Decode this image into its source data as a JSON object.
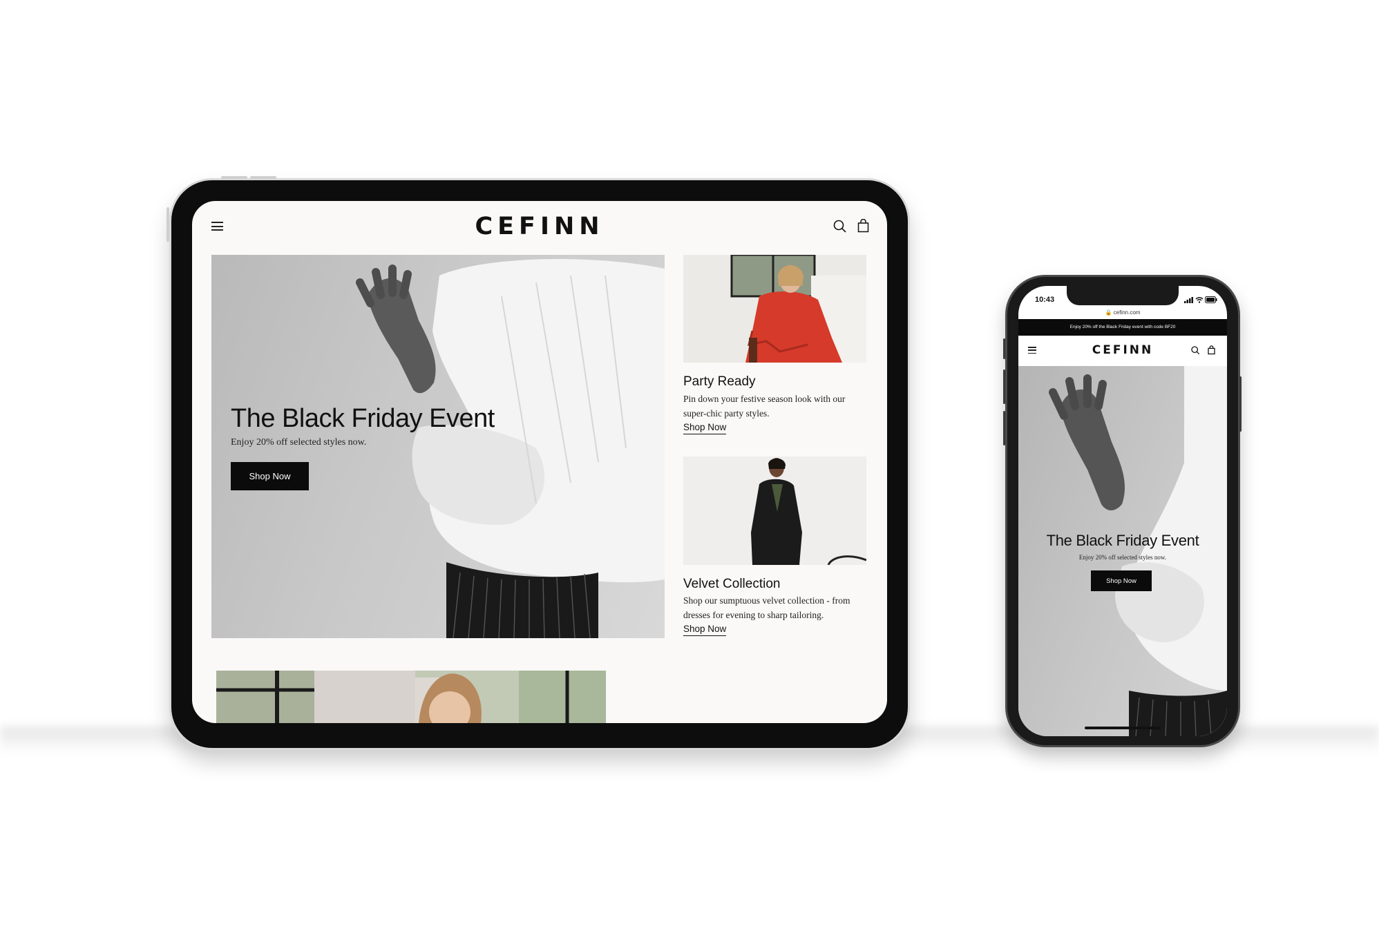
{
  "brand": {
    "logo": "CEFINN"
  },
  "tablet": {
    "hero": {
      "title": "The Black Friday Event",
      "subtitle": "Enjoy 20% off selected styles now.",
      "cta": "Shop Now"
    },
    "cards": [
      {
        "title": "Party Ready",
        "description": "Pin down your festive season look with our super-chic party styles.",
        "link": "Shop Now"
      },
      {
        "title": "Velvet Collection",
        "description": "Shop our sumptuous velvet collection - from dresses for evening to sharp tailoring.",
        "link": "Shop Now"
      }
    ]
  },
  "phone": {
    "status_time": "10:43",
    "url": "cefinn.com",
    "promo": "Enjoy 20% off the Black Friday event with code BF20",
    "hero": {
      "title": "The Black Friday Event",
      "subtitle": "Enjoy 20% off selected styles now.",
      "cta": "Shop Now"
    }
  },
  "icons": [
    "menu-icon",
    "search-icon",
    "bag-icon",
    "lock-icon",
    "signal-icon",
    "wifi-icon",
    "battery-icon"
  ]
}
